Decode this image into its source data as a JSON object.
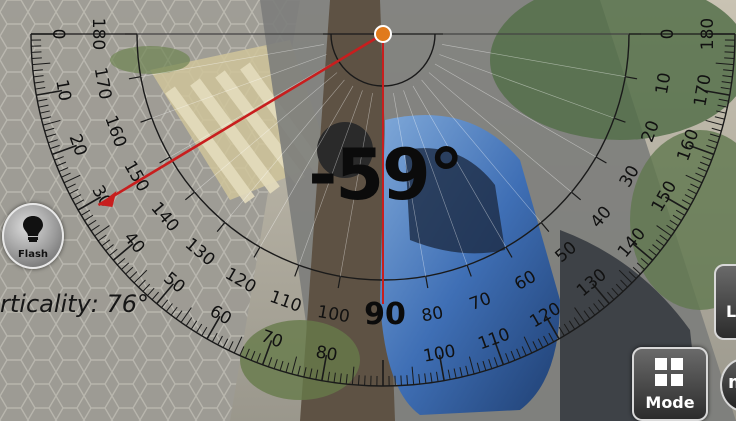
{
  "readout": {
    "angle": "-59°",
    "center_value": "90",
    "verticality": "rticality: 76°"
  },
  "buttons": {
    "flash_label": "Flash",
    "mode_label": "Mode",
    "side_glyph": "L",
    "round_glyph": "m"
  },
  "protractor": {
    "outer_labels_left": [
      "0",
      "10",
      "20",
      "30",
      "40",
      "50",
      "60",
      "70",
      "80"
    ],
    "inner_labels_left": [
      "180",
      "170",
      "160",
      "150",
      "140",
      "130",
      "120",
      "110",
      "100"
    ],
    "outer_labels_right": [
      "100",
      "110",
      "120",
      "130",
      "140",
      "150",
      "160",
      "170",
      "180"
    ],
    "inner_labels_right": [
      "80",
      "70",
      "60",
      "50",
      "40",
      "30",
      "20",
      "10",
      "0"
    ],
    "color_ticks": "#1a1a1a",
    "color_needle": "#c81e1e"
  },
  "icons": {
    "flash": "lightbulb-icon",
    "mode": "grid-icon"
  }
}
